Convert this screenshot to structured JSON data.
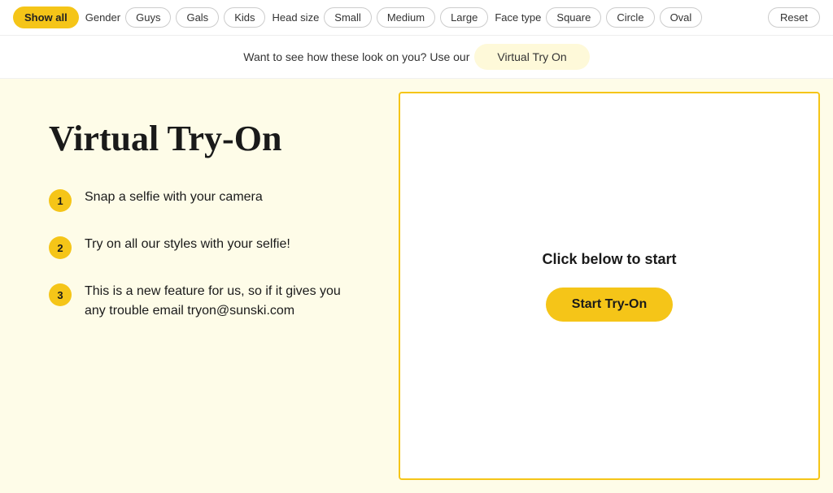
{
  "filterBar": {
    "showAll": "Show all",
    "gender": {
      "label": "Gender",
      "options": [
        "Guys",
        "Gals",
        "Kids"
      ]
    },
    "headSize": {
      "label": "Head size",
      "options": [
        "Small",
        "Medium",
        "Large"
      ]
    },
    "faceType": {
      "label": "Face type",
      "options": [
        "Square",
        "Circle",
        "Oval"
      ]
    },
    "reset": "Reset"
  },
  "banner": {
    "text": "Want to see how these look on you? Use our",
    "buttonLabel": "Virtual Try On"
  },
  "leftPanel": {
    "title": "Virtual Try-On",
    "steps": [
      {
        "number": "1",
        "text": "Snap a selfie with your camera"
      },
      {
        "number": "2",
        "text": "Try on all our styles with your selfie!"
      },
      {
        "number": "3",
        "text": "This is a new feature for us, so if it gives you any trouble email tryon@sunski.com"
      }
    ]
  },
  "rightPanel": {
    "clickLabel": "Click below to start",
    "startButton": "Start Try-On"
  }
}
